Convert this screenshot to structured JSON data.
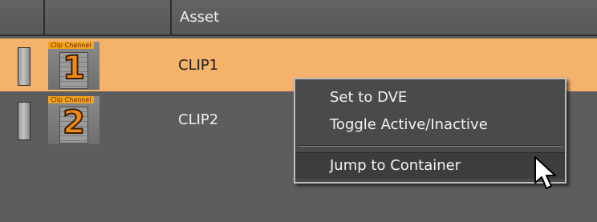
{
  "table": {
    "header": {
      "asset_label": "Asset"
    },
    "rows": [
      {
        "asset": "CLIP1",
        "thumb_tag": "Clip Channel",
        "thumb_number": "1",
        "selected": true
      },
      {
        "asset": "CLIP2",
        "thumb_tag": "Clip Channel",
        "thumb_number": "2",
        "selected": false
      }
    ]
  },
  "context_menu": {
    "items": [
      {
        "label": "Set to DVE"
      },
      {
        "label": "Toggle Active/Inactive"
      },
      {
        "label": "Jump to Container"
      }
    ]
  },
  "colors": {
    "selected_row": "#f4b26a",
    "background": "#5d5d5d",
    "menu_background": "#4a4a4a",
    "thumb_accent": "#f08a16"
  },
  "icons": [
    "channel-slot-icon",
    "clip-channel-thumbnail-icon",
    "mouse-pointer-icon"
  ]
}
